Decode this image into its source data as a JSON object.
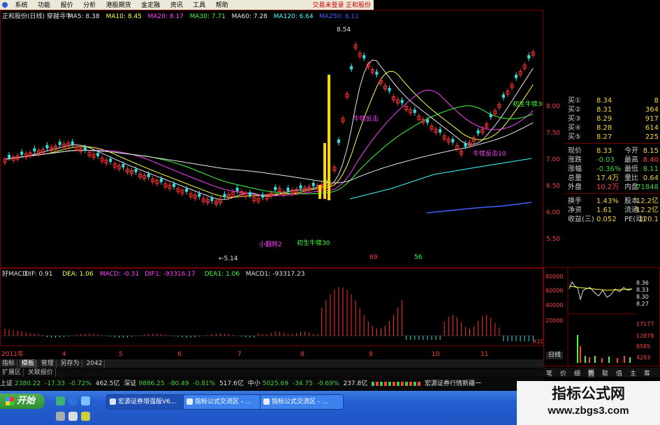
{
  "menubar": {
    "items": [
      "系统",
      "功能",
      "报价",
      "分析",
      "港股期货",
      "金定融",
      "资讯",
      "工具",
      "帮助"
    ],
    "login": "交易未登录  正和股份"
  },
  "main": {
    "title": "正和股份(日线) 穿越寻牛",
    "indicators": [
      {
        "label": "MA5: 8.38",
        "color": "#e8e8e8"
      },
      {
        "label": "MA10: 8.45",
        "color": "#ffff40"
      },
      {
        "label": "MA20: 8.17",
        "color": "#ff40ff"
      },
      {
        "label": "MA30: 7.71",
        "color": "#40ff40"
      },
      {
        "label": "MA60: 7.28",
        "color": "#e8e8e8"
      },
      {
        "label": "MA120: 6.64",
        "color": "#40ffff"
      },
      {
        "label": "MA250: 6.11",
        "color": "#4060ff"
      }
    ],
    "high_mark": "8.54",
    "low_mark": "←5.14",
    "ann1": "初生牛犊30",
    "ann2": "初生牛犊30",
    "ann3": "牛犊反击",
    "ann4": "小翻转2",
    "ann5": "牛犊反击10",
    "num1": "69",
    "num2": "56",
    "price_axis": [
      "8.00",
      "7.50",
      "7.00",
      "6.50",
      "6.00",
      "5.50"
    ]
  },
  "macd": {
    "legend": [
      {
        "label": "好MACD",
        "color": "#e0e0e0"
      },
      {
        "label": "DIF: 0.91",
        "color": "#e0e0e0"
      },
      {
        "label": "DEA: 1.06",
        "color": "#ffff40"
      },
      {
        "label": "MACD: -0.31",
        "color": "#ff40ff"
      },
      {
        "label": "DIF1: -93316.17",
        "color": "#ff40ff"
      },
      {
        "label": "DEA1: 1.06",
        "color": "#40ff40"
      },
      {
        "label": "MACD1: -93317.23",
        "color": "#e0e0e0"
      }
    ]
  },
  "dates": [
    "2011年",
    "4",
    "5",
    "6",
    "7",
    "8",
    "9",
    "10",
    "11"
  ],
  "quote": {
    "rows": [
      {
        "label": "买①",
        "v1": "8.34",
        "v2": "8"
      },
      {
        "label": "买②",
        "v1": "8.31",
        "v2": "364"
      },
      {
        "label": "买③",
        "v1": "8.29",
        "v2": "917"
      },
      {
        "label": "买④",
        "v1": "8.28",
        "v2": "614"
      },
      {
        "label": "买⑤",
        "v1": "8.27",
        "v2": "225"
      },
      {
        "label": "现价",
        "v1": "8.33",
        "l2": "今开",
        "v2": "8.15"
      },
      {
        "label": "涨跌",
        "v1": "-0.03",
        "l2": "最高",
        "v2": "8.40"
      },
      {
        "label": "涨幅",
        "v1": "-0.36%",
        "l2": "最低",
        "v2": "8.11"
      },
      {
        "label": "总量",
        "v1": "17.4万",
        "l2": "量比",
        "v2": "0.64"
      },
      {
        "label": "外盘",
        "v1": "10.2万",
        "l2": "内盘",
        "v2": "71848"
      },
      {
        "label": "换手",
        "v1": "1.43%",
        "l2": "股本",
        "v2": "12.2亿"
      },
      {
        "label": "净资",
        "v1": "1.61",
        "l2": "流通",
        "v2": "12.2亿"
      },
      {
        "label": "收益(三)",
        "v1": "0.052",
        "l2": "PE(动)",
        "v2": "120.1"
      }
    ]
  },
  "intraday": {
    "left_axis": [
      "80000",
      "60000",
      "40000",
      "20000"
    ],
    "right_axis": [
      "8.36",
      "8.33",
      "8.30",
      "8.27"
    ],
    "vol_axis": [
      "17177",
      "12878",
      "8585",
      "4293"
    ],
    "x10": "X10"
  },
  "bottomtabs": {
    "tabs": [
      "指标",
      "模板",
      "管理",
      "另存为",
      "2042"
    ],
    "selected": 1
  },
  "subtabs": {
    "tabs": [
      "扩展区",
      "关联报价"
    ]
  },
  "right_tabs": [
    "笔",
    "价",
    "细",
    "势",
    "联",
    "值",
    "主",
    "筹"
  ],
  "status": {
    "sh": {
      "label": "上证",
      "value": "2380.22",
      "chg": "-17.33",
      "pct": "-0.72%",
      "amt": "462.5亿"
    },
    "sz": {
      "label": "深证",
      "value": "9886.25",
      "chg": "-80.49",
      "pct": "-0.81%",
      "amt": "517.6亿"
    },
    "zx": {
      "label": "中小",
      "value": "5025.69",
      "chg": "-34.75",
      "pct": "-0.69%",
      "amt": "237.8亿"
    },
    "ticker": "宏源证券行情新疆一"
  },
  "rightpanel_tab": "日线",
  "taskbar": {
    "start": "开始",
    "tasks": [
      "宏源证券增强版V6...",
      "指标公式交流区 - ...",
      "指标公式交流区 - ..."
    ]
  },
  "watermark": {
    "line1": "指标公式网",
    "line2": "www.zbgs3.com"
  },
  "colors": {
    "up": "#ff3030",
    "down": "#30e0e0",
    "bg": "#000000",
    "frame": "#7a0000"
  }
}
